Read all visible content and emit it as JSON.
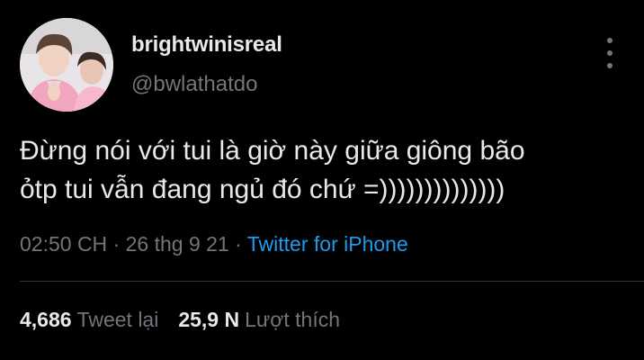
{
  "tweet": {
    "display_name": "brightwinisreal",
    "handle": "@bwlathatdo",
    "text": "Đừng nói với tui là giờ này giữa giông bão\nỏtp tui vẫn đang ngủ đó chứ =))))))))))))))",
    "time": "02:50 CH",
    "separator": "·",
    "date": "26 thg 9 21",
    "source": "Twitter for iPhone",
    "more_icon": "more-vertical-icon"
  },
  "stats": {
    "retweets_count": "4,686",
    "retweets_label": "Tweet lại",
    "likes_count": "25,9 N",
    "likes_label": "Lượt thích"
  },
  "colors": {
    "background": "#000000",
    "text": "#e7e9ea",
    "muted": "#71767b",
    "accent": "#1d9bf0",
    "divider": "#2f3336"
  }
}
